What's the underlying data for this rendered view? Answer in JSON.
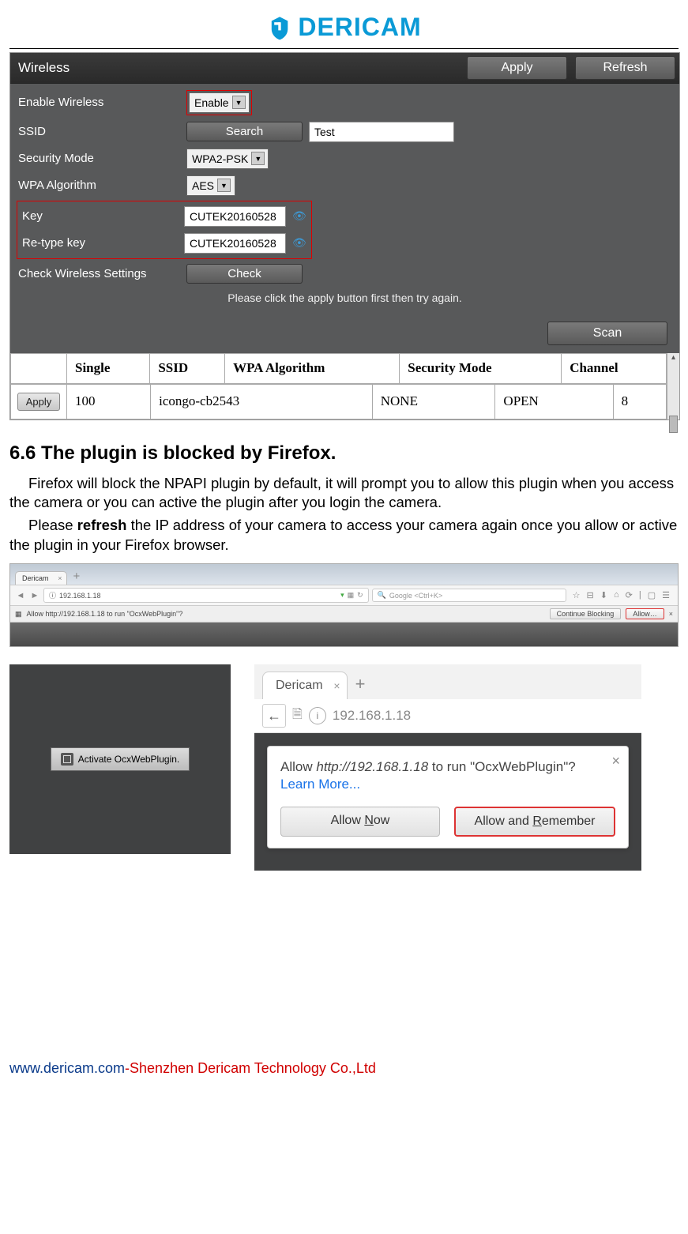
{
  "brand": "DERICAM",
  "wireless": {
    "title": "Wireless",
    "apply": "Apply",
    "refresh": "Refresh",
    "scan": "Scan",
    "labels": {
      "enable": "Enable Wireless",
      "ssid": "SSID",
      "security": "Security Mode",
      "wpa": "WPA Algorithm",
      "key": "Key",
      "rekey": "Re-type key",
      "check": "Check Wireless Settings"
    },
    "values": {
      "enable": "Enable",
      "search": "Search",
      "ssid": "Test",
      "security": "WPA2-PSK",
      "wpa": "AES",
      "key": "CUTEK20160528",
      "rekey": "CUTEK20160528",
      "check": "Check"
    },
    "hint": "Please click the apply button first then try again.",
    "table": {
      "apply": "Apply",
      "headers": [
        "Single",
        "SSID",
        "WPA Algorithm",
        "Security Mode",
        "Channel"
      ],
      "row": [
        "100",
        "icongo-cb2543",
        "NONE",
        "OPEN",
        "8"
      ]
    }
  },
  "section": {
    "title": "6.6 The plugin is blocked by Firefox.",
    "p1a": "Firefox will block the NPAPI plugin by default, it will prompt you to allow this plugin when you access the camera or you can active the plugin after you login the camera.",
    "p2a": "Please ",
    "p2b": "refresh",
    "p2c": " the IP address of your camera to access your camera again once you allow or active the plugin in your Firefox browser."
  },
  "firefox_bar": {
    "tab": "Dericam",
    "url": "192.168.1.18",
    "search_placeholder": "Google <Ctrl+K>",
    "plugin_msg": "Allow http://192.168.1.18 to run \"OcxWebPlugin\"?",
    "continue": "Continue Blocking",
    "allow": "Allow…"
  },
  "panel_left": {
    "btn": "Activate OcxWebPlugin."
  },
  "panel_right": {
    "tab": "Dericam",
    "url": "192.168.1.18",
    "msg_pre": "Allow ",
    "msg_url": "http://192.168.1.18",
    "msg_post": " to run \"OcxWebPlugin\"?",
    "learn": "Learn More...",
    "btn_now": "Allow Now",
    "btn_remember": "Allow and Remember"
  },
  "footer": {
    "link": "www.dericam.com",
    "dash": "-",
    "company": "Shenzhen Dericam Technology Co.,Ltd"
  }
}
